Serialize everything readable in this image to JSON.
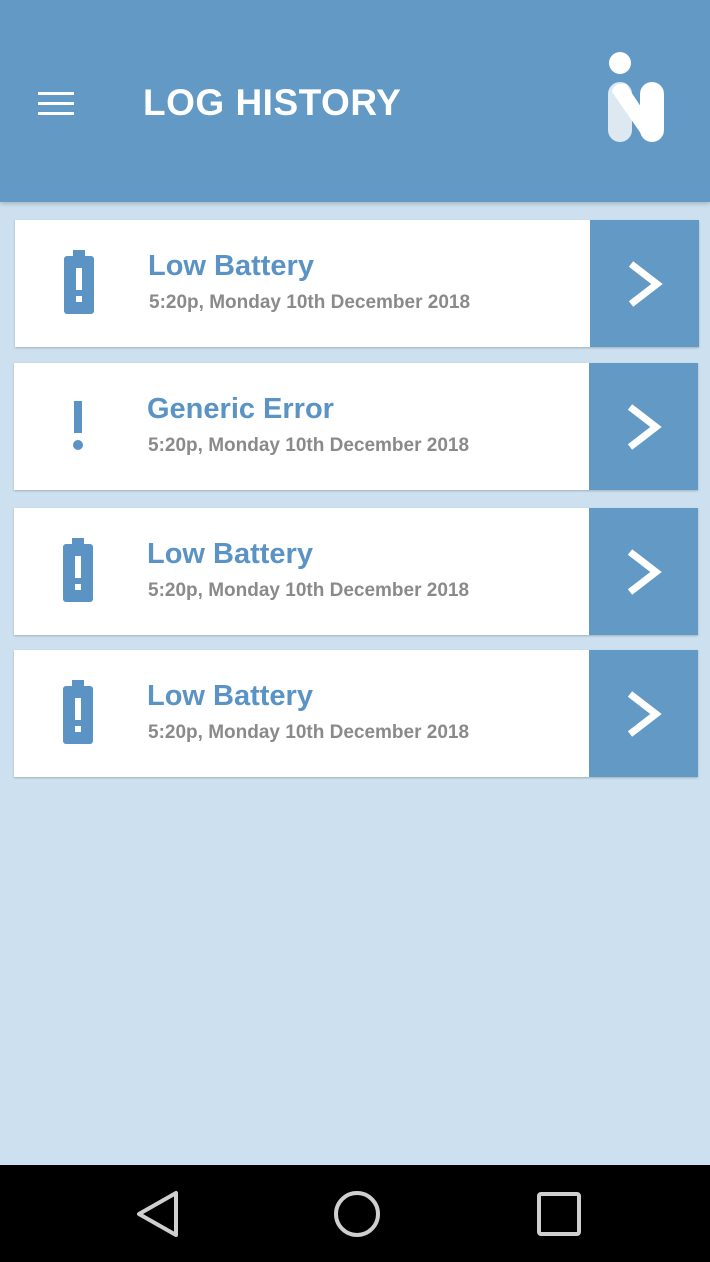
{
  "header": {
    "title": "LOG HISTORY",
    "menu_icon": "hamburger-menu-icon",
    "logo_icon": "brand-logo-icon"
  },
  "colors": {
    "header_bg": "#6399c5",
    "page_bg": "#cce0ef",
    "accent": "#5a93c4",
    "meta_text": "#8a8a8a",
    "nav_bg": "#000000"
  },
  "logs": [
    {
      "title": "Low Battery",
      "timestamp": "5:20p, Monday 10th December 2018",
      "icon": "battery-alert-icon"
    },
    {
      "title": "Generic Error",
      "timestamp": "5:20p, Monday 10th December 2018",
      "icon": "exclamation-icon"
    },
    {
      "title": "Low Battery",
      "timestamp": "5:20p, Monday 10th December 2018",
      "icon": "battery-alert-icon"
    },
    {
      "title": "Low Battery",
      "timestamp": "5:20p, Monday 10th December 2018",
      "icon": "battery-alert-icon"
    }
  ],
  "nav": {
    "back_icon": "back-triangle-icon",
    "home_icon": "home-circle-icon",
    "recents_icon": "recents-square-icon"
  }
}
